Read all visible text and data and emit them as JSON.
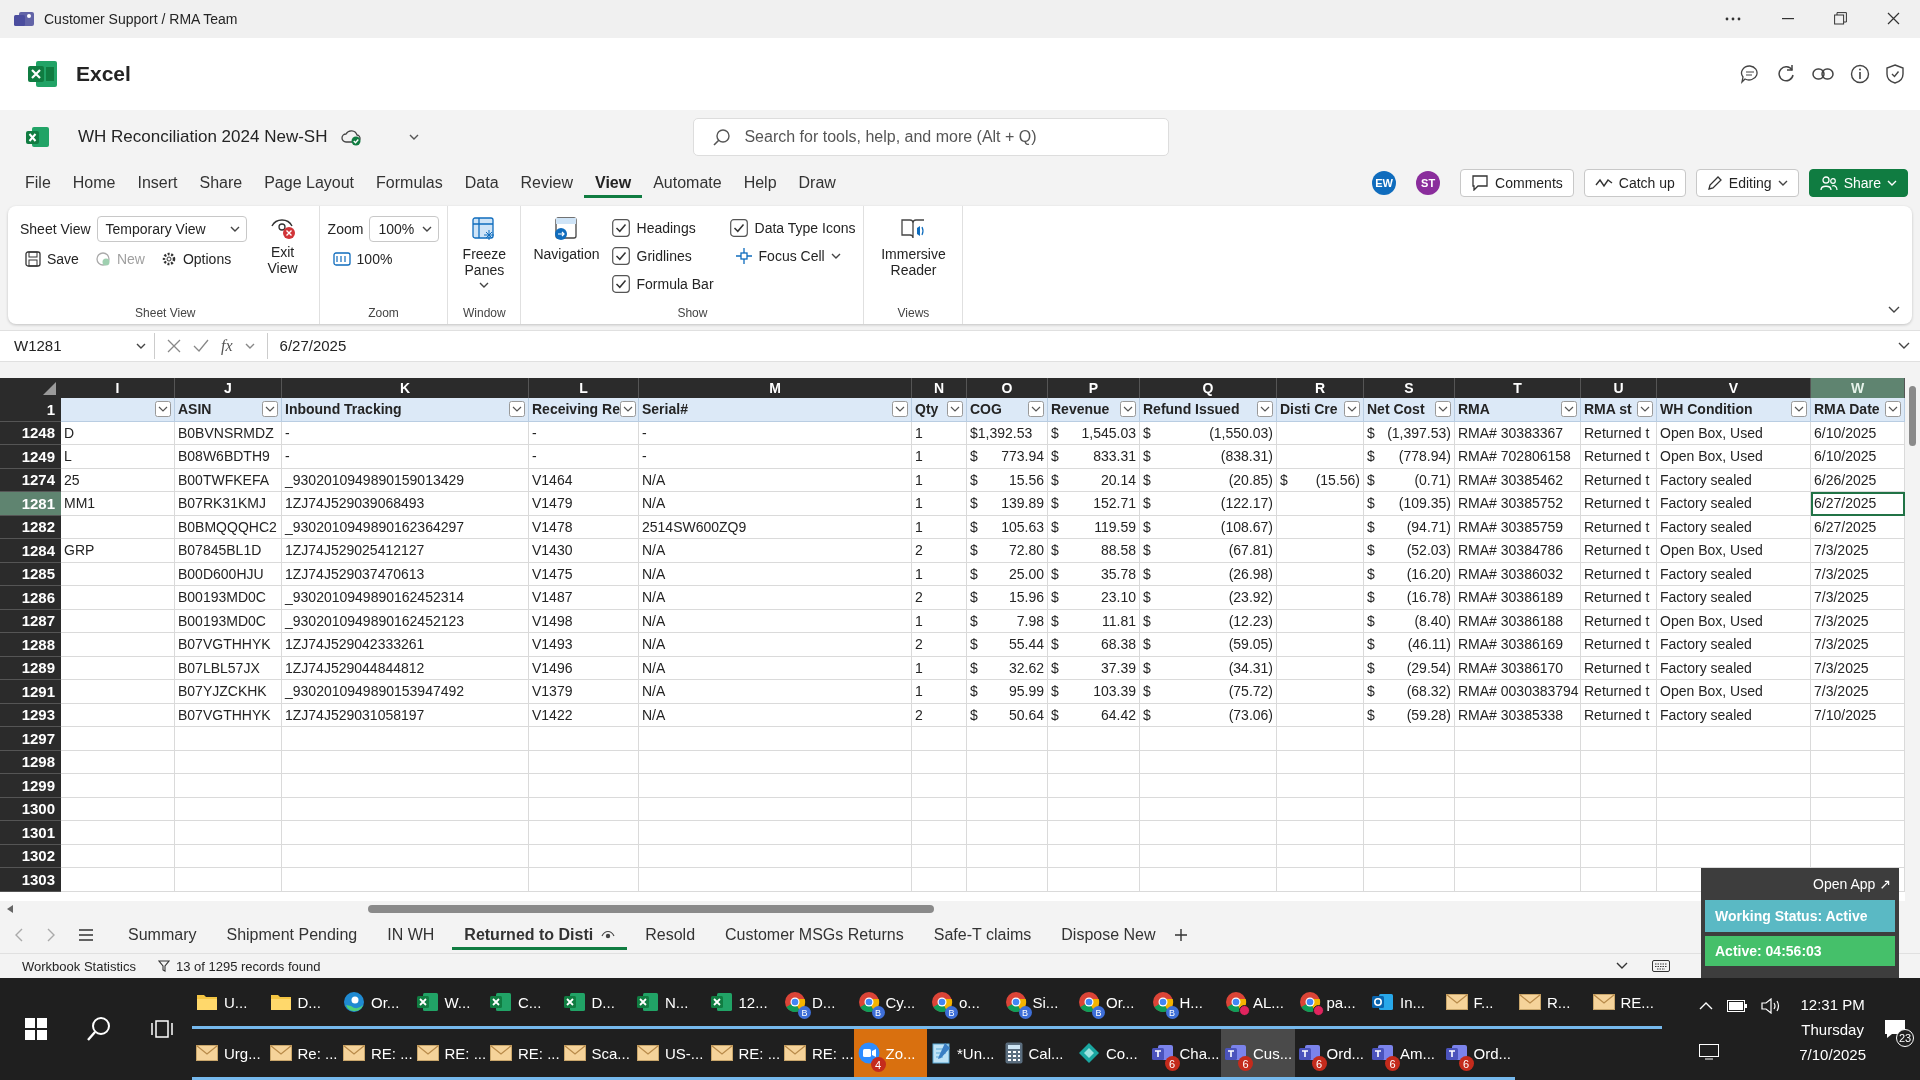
{
  "window": {
    "title": "Customer Support / RMA Team"
  },
  "app": {
    "name": "Excel"
  },
  "document": {
    "title": "WH Reconciliation 2024 New-SH"
  },
  "search": {
    "placeholder": "Search for tools, help, and more (Alt + Q)"
  },
  "menu_tabs": [
    {
      "label": "File",
      "selected": false
    },
    {
      "label": "Home",
      "selected": false
    },
    {
      "label": "Insert",
      "selected": false
    },
    {
      "label": "Share",
      "selected": false
    },
    {
      "label": "Page Layout",
      "selected": false
    },
    {
      "label": "Formulas",
      "selected": false
    },
    {
      "label": "Data",
      "selected": false
    },
    {
      "label": "Review",
      "selected": false
    },
    {
      "label": "View",
      "selected": true
    },
    {
      "label": "Automate",
      "selected": false
    },
    {
      "label": "Help",
      "selected": false
    },
    {
      "label": "Draw",
      "selected": false
    }
  ],
  "collaborators": [
    {
      "initials": "EW",
      "color": "#0f6cbd"
    },
    {
      "initials": "ST",
      "color": "#8a2d9c"
    }
  ],
  "header_buttons": [
    {
      "kind": "comments",
      "label": "Comments"
    },
    {
      "kind": "catchup",
      "label": "Catch up"
    },
    {
      "kind": "editing",
      "label": "Editing"
    },
    {
      "kind": "share",
      "label": "Share"
    }
  ],
  "ribbon": {
    "sheet_view": {
      "field_label": "Sheet View",
      "dropdown": "Temporary View",
      "buttons": [
        {
          "kind": "save",
          "label": "Save",
          "disabled": false
        },
        {
          "kind": "new",
          "label": "New",
          "disabled": true
        },
        {
          "kind": "options",
          "label": "Options",
          "disabled": false
        }
      ],
      "exit_button": "Exit View",
      "group_label": "Sheet View"
    },
    "zoom": {
      "field_label": "Zoom",
      "dropdown": "100%",
      "button": "100%",
      "group_label": "Zoom"
    },
    "window": {
      "button": "Freeze Panes",
      "group_label": "Window"
    },
    "show": {
      "button": "Navigation",
      "checkboxes": [
        {
          "label": "Headings",
          "checked": true
        },
        {
          "label": "Gridlines",
          "checked": true
        },
        {
          "label": "Formula Bar",
          "checked": true
        },
        {
          "label": "Data Type Icons",
          "checked": true
        }
      ],
      "focus_button": "Focus Cell",
      "group_label": "Show"
    },
    "views": {
      "button": "Immersive Reader",
      "group_label": "Views"
    }
  },
  "formula_bar": {
    "name_box": "W1281",
    "function_label": "fx",
    "value": "6/27/2025"
  },
  "table": {
    "header_row": "1",
    "columns": [
      {
        "letter": "I",
        "kind": "text",
        "selected": false
      },
      {
        "letter": "J",
        "header": "ASIN",
        "kind": "text",
        "selected": false
      },
      {
        "letter": "K",
        "header": "Inbound Tracking",
        "kind": "text",
        "selected": false
      },
      {
        "letter": "L",
        "header": "Receiving Re",
        "kind": "text",
        "selected": false
      },
      {
        "letter": "M",
        "header": "Serial#",
        "kind": "text",
        "selected": false
      },
      {
        "letter": "N",
        "header": "Qty",
        "kind": "text",
        "selected": false
      },
      {
        "letter": "O",
        "header": "COG",
        "kind": "money",
        "selected": false
      },
      {
        "letter": "P",
        "header": "Revenue",
        "kind": "money",
        "selected": false
      },
      {
        "letter": "Q",
        "header": "Refund Issued",
        "kind": "money",
        "selected": false
      },
      {
        "letter": "R",
        "header": "Disti Cre",
        "kind": "money",
        "selected": false
      },
      {
        "letter": "S",
        "header": "Net Cost",
        "kind": "money",
        "selected": false
      },
      {
        "letter": "T",
        "header": "RMA",
        "kind": "text",
        "selected": false
      },
      {
        "letter": "U",
        "header": "RMA st",
        "kind": "text",
        "selected": false
      },
      {
        "letter": "V",
        "header": "WH Condition",
        "kind": "text",
        "selected": false
      },
      {
        "letter": "W",
        "header": "RMA Date",
        "kind": "text",
        "selected": true
      }
    ],
    "rows": [
      {
        "number": "1248",
        "selected": false,
        "cells": [
          "D",
          "B0BVNSRMDZ",
          "-",
          "-",
          "-",
          "1",
          "$1,392.53",
          {
            "symbol": "$",
            "value": "1,545.03"
          },
          {
            "symbol": "$",
            "value": "(1,550.03)"
          },
          null,
          {
            "symbol": "$",
            "value": "(1,397.53)"
          },
          "RMA# 30383367",
          "Returned t",
          "Open Box, Used",
          "6/10/2025"
        ]
      },
      {
        "number": "1249",
        "selected": false,
        "cells": [
          "L",
          "B08W6BDTH9",
          "-",
          "-",
          "-",
          "1",
          {
            "symbol": "$",
            "value": "773.94"
          },
          {
            "symbol": "$",
            "value": "833.31"
          },
          {
            "symbol": "$",
            "value": "(838.31)"
          },
          null,
          {
            "symbol": "$",
            "value": "(778.94)"
          },
          "RMA# 702806158",
          "Returned t",
          "Open Box, Used",
          "6/10/2025"
        ]
      },
      {
        "number": "1274",
        "selected": false,
        "cells": [
          "25",
          "B00TWFKEFA",
          "_9302010949890159013429",
          "V1464",
          "N/A",
          "1",
          {
            "symbol": "$",
            "value": "15.56"
          },
          {
            "symbol": "$",
            "value": "20.14"
          },
          {
            "symbol": "$",
            "value": "(20.85)"
          },
          {
            "symbol": "$",
            "value": "(15.56)"
          },
          {
            "symbol": "$",
            "value": "(0.71)"
          },
          "RMA# 30385462",
          "Returned t",
          "Factory sealed",
          "6/26/2025"
        ]
      },
      {
        "number": "1281",
        "selected": true,
        "cells": [
          "MM1",
          "B07RK31KMJ",
          "1ZJ74J529039068493",
          "V1479",
          "N/A",
          "1",
          {
            "symbol": "$",
            "value": "139.89"
          },
          {
            "symbol": "$",
            "value": "152.71"
          },
          {
            "symbol": "$",
            "value": "(122.17)"
          },
          null,
          {
            "symbol": "$",
            "value": "(109.35)"
          },
          "RMA# 30385752",
          "Returned t",
          "Factory sealed",
          "6/27/2025"
        ]
      },
      {
        "number": "1282",
        "selected": false,
        "cells": [
          null,
          "B0BMQQQHC2",
          "_9302010949890162364297",
          "V1478",
          "2514SW600ZQ9",
          "1",
          {
            "symbol": "$",
            "value": "105.63"
          },
          {
            "symbol": "$",
            "value": "119.59"
          },
          {
            "symbol": "$",
            "value": "(108.67)"
          },
          null,
          {
            "symbol": "$",
            "value": "(94.71)"
          },
          "RMA# 30385759",
          "Returned t",
          "Factory sealed",
          "6/27/2025"
        ]
      },
      {
        "number": "1284",
        "selected": false,
        "cells": [
          "GRP",
          "B07845BL1D",
          "1ZJ74J529025412127",
          "V1430",
          "N/A",
          "2",
          {
            "symbol": "$",
            "value": "72.80"
          },
          {
            "symbol": "$",
            "value": "88.58"
          },
          {
            "symbol": "$",
            "value": "(67.81)"
          },
          null,
          {
            "symbol": "$",
            "value": "(52.03)"
          },
          "RMA# 30384786",
          "Returned t",
          "Open Box, Used",
          "7/3/2025"
        ]
      },
      {
        "number": "1285",
        "selected": false,
        "cells": [
          null,
          "B00D600HJU",
          "1ZJ74J529037470613",
          "V1475",
          "N/A",
          "1",
          {
            "symbol": "$",
            "value": "25.00"
          },
          {
            "symbol": "$",
            "value": "35.78"
          },
          {
            "symbol": "$",
            "value": "(26.98)"
          },
          null,
          {
            "symbol": "$",
            "value": "(16.20)"
          },
          "RMA# 30386032",
          "Returned t",
          "Factory sealed",
          "7/3/2025"
        ]
      },
      {
        "number": "1286",
        "selected": false,
        "cells": [
          null,
          "B00193MD0C",
          "_9302010949890162452314",
          "V1487",
          "N/A",
          "2",
          {
            "symbol": "$",
            "value": "15.96"
          },
          {
            "symbol": "$",
            "value": "23.10"
          },
          {
            "symbol": "$",
            "value": "(23.92)"
          },
          null,
          {
            "symbol": "$",
            "value": "(16.78)"
          },
          "RMA# 30386189",
          "Returned t",
          "Factory sealed",
          "7/3/2025"
        ]
      },
      {
        "number": "1287",
        "selected": false,
        "cells": [
          null,
          "B00193MD0C",
          "_9302010949890162452123",
          "V1498",
          "N/A",
          "1",
          {
            "symbol": "$",
            "value": "7.98"
          },
          {
            "symbol": "$",
            "value": "11.81"
          },
          {
            "symbol": "$",
            "value": "(12.23)"
          },
          null,
          {
            "symbol": "$",
            "value": "(8.40)"
          },
          "RMA# 30386188",
          "Returned t",
          "Open Box, Used",
          "7/3/2025"
        ]
      },
      {
        "number": "1288",
        "selected": false,
        "cells": [
          null,
          "B07VGTHHYK",
          "1ZJ74J529042333261",
          "V1493",
          "N/A",
          "2",
          {
            "symbol": "$",
            "value": "55.44"
          },
          {
            "symbol": "$",
            "value": "68.38"
          },
          {
            "symbol": "$",
            "value": "(59.05)"
          },
          null,
          {
            "symbol": "$",
            "value": "(46.11)"
          },
          "RMA# 30386169",
          "Returned t",
          "Factory sealed",
          "7/3/2025"
        ]
      },
      {
        "number": "1289",
        "selected": false,
        "cells": [
          null,
          "B07LBL57JX",
          "1ZJ74J529044844812",
          "V1496",
          "N/A",
          "1",
          {
            "symbol": "$",
            "value": "32.62"
          },
          {
            "symbol": "$",
            "value": "37.39"
          },
          {
            "symbol": "$",
            "value": "(34.31)"
          },
          null,
          {
            "symbol": "$",
            "value": "(29.54)"
          },
          "RMA# 30386170",
          "Returned t",
          "Factory sealed",
          "7/3/2025"
        ]
      },
      {
        "number": "1291",
        "selected": false,
        "cells": [
          null,
          "B07YJZCKHK",
          "_9302010949890153947492",
          "V1379",
          "N/A",
          "1",
          {
            "symbol": "$",
            "value": "95.99"
          },
          {
            "symbol": "$",
            "value": "103.39"
          },
          {
            "symbol": "$",
            "value": "(75.72)"
          },
          null,
          {
            "symbol": "$",
            "value": "(68.32)"
          },
          "RMA# 0030383794",
          "Returned t",
          "Open Box, Used",
          "7/3/2025"
        ]
      },
      {
        "number": "1293",
        "selected": false,
        "cells": [
          null,
          "B07VGTHHYK",
          "1ZJ74J529031058197",
          "V1422",
          "N/A",
          "2",
          {
            "symbol": "$",
            "value": "50.64"
          },
          {
            "symbol": "$",
            "value": "64.42"
          },
          {
            "symbol": "$",
            "value": "(73.06)"
          },
          null,
          {
            "symbol": "$",
            "value": "(59.28)"
          },
          "RMA# 30385338",
          "Returned t",
          "Factory sealed",
          "7/10/2025"
        ]
      },
      {
        "number": "1297",
        "selected": false
      },
      {
        "number": "1298",
        "selected": false
      },
      {
        "number": "1299",
        "selected": false
      },
      {
        "number": "1300",
        "selected": false
      },
      {
        "number": "1301",
        "selected": false
      },
      {
        "number": "1302",
        "selected": false
      },
      {
        "number": "1303",
        "selected": false
      }
    ]
  },
  "sheet_tabs": [
    {
      "label": "Summary",
      "selected": false
    },
    {
      "label": "Shipment Pending",
      "selected": false
    },
    {
      "label": "IN WH",
      "selected": false
    },
    {
      "label": "Returned to Disti",
      "selected": true
    },
    {
      "label": "Resold",
      "selected": false
    },
    {
      "label": "Customer MSGs Returns",
      "selected": false
    },
    {
      "label": "Safe-T claims",
      "selected": false
    },
    {
      "label": "Dispose New",
      "selected": false
    }
  ],
  "status_bar": {
    "statistics": "Workbook Statistics",
    "filter": "13 of 1295 records found"
  },
  "overlay": {
    "link": "Open App ↗",
    "status_button": "Working Status: Active",
    "timer": "Active: 04:56:03"
  },
  "taskbar": {
    "rows": [
      [
        {
          "kind": "folder",
          "label": "U...",
          "active": false,
          "attention": false
        },
        {
          "kind": "folder",
          "label": "D...",
          "active": false,
          "attention": false
        },
        {
          "kind": "edge",
          "label": "Or...",
          "active": false,
          "attention": false
        },
        {
          "kind": "excel",
          "label": "W...",
          "active": false,
          "attention": false
        },
        {
          "kind": "excel",
          "label": "C...",
          "active": false,
          "attention": false
        },
        {
          "kind": "excel",
          "label": "D...",
          "active": false,
          "attention": false
        },
        {
          "kind": "excel",
          "label": "N...",
          "active": false,
          "attention": false
        },
        {
          "kind": "excel",
          "label": "12...",
          "active": false,
          "attention": false
        },
        {
          "kind": "chrome",
          "label": "D...",
          "profile": "B",
          "active": false,
          "attention": false
        },
        {
          "kind": "chrome",
          "label": "Cy...",
          "profile": "B",
          "active": false,
          "attention": false
        },
        {
          "kind": "chrome",
          "label": "o...",
          "profile": "B",
          "active": false,
          "attention": false
        },
        {
          "kind": "chrome",
          "label": "Si...",
          "profile": "B",
          "active": false,
          "attention": false
        },
        {
          "kind": "chrome",
          "label": "Or...",
          "profile": "B",
          "active": false,
          "attention": false
        },
        {
          "kind": "chrome",
          "label": "H...",
          "profile": "B",
          "active": false,
          "attention": false
        },
        {
          "kind": "chrome",
          "label": "AL...",
          "alert": true,
          "active": false,
          "attention": false
        },
        {
          "kind": "chrome",
          "label": "pa...",
          "alert": true,
          "active": false,
          "attention": false
        },
        {
          "kind": "outlook",
          "label": "In...",
          "active": false,
          "attention": false
        },
        {
          "kind": "mail",
          "label": "F...",
          "active": false,
          "attention": false
        },
        {
          "kind": "mail",
          "label": "R...",
          "active": false,
          "attention": false
        },
        {
          "kind": "mail",
          "label": "RE...",
          "active": false,
          "attention": false
        }
      ],
      [
        {
          "kind": "mail",
          "label": "Urg...",
          "active": false,
          "attention": false
        },
        {
          "kind": "mail",
          "label": "Re: ...",
          "active": false,
          "attention": false
        },
        {
          "kind": "mail",
          "label": "RE: ...",
          "active": false,
          "attention": false
        },
        {
          "kind": "mail",
          "label": "RE: ...",
          "active": false,
          "attention": false
        },
        {
          "kind": "mail",
          "label": "RE: ...",
          "active": false,
          "attention": false
        },
        {
          "kind": "mail",
          "label": "Sca...",
          "active": false,
          "attention": false
        },
        {
          "kind": "mail",
          "label": "US-...",
          "active": false,
          "attention": false
        },
        {
          "kind": "mail",
          "label": "RE: ...",
          "active": false,
          "attention": false
        },
        {
          "kind": "mail",
          "label": "RE: ...",
          "active": false,
          "attention": false
        },
        {
          "kind": "zoom",
          "label": "Zo...",
          "badge": "4",
          "active": false,
          "attention": true
        },
        {
          "kind": "notepad",
          "label": "*Un...",
          "active": false,
          "attention": false
        },
        {
          "kind": "calculator",
          "label": "Cal...",
          "active": false,
          "attention": false
        },
        {
          "kind": "diamond",
          "label": "Co...",
          "active": false,
          "attention": false
        },
        {
          "kind": "teams",
          "label": "Cha...",
          "badge": "6",
          "active": false,
          "attention": false
        },
        {
          "kind": "teams",
          "label": "Cus...",
          "badge": "6",
          "active": true,
          "attention": false
        },
        {
          "kind": "teams",
          "label": "Ord...",
          "badge": "6",
          "active": false,
          "attention": false
        },
        {
          "kind": "teams",
          "label": "Am...",
          "badge": "6",
          "active": false,
          "attention": false
        },
        {
          "kind": "teams",
          "label": "Ord...",
          "badge": "6",
          "active": false,
          "attention": false
        }
      ]
    ],
    "clock": {
      "time": "12:31 PM",
      "day": "Thursday",
      "date": "7/10/2025"
    },
    "notifications": "23"
  }
}
